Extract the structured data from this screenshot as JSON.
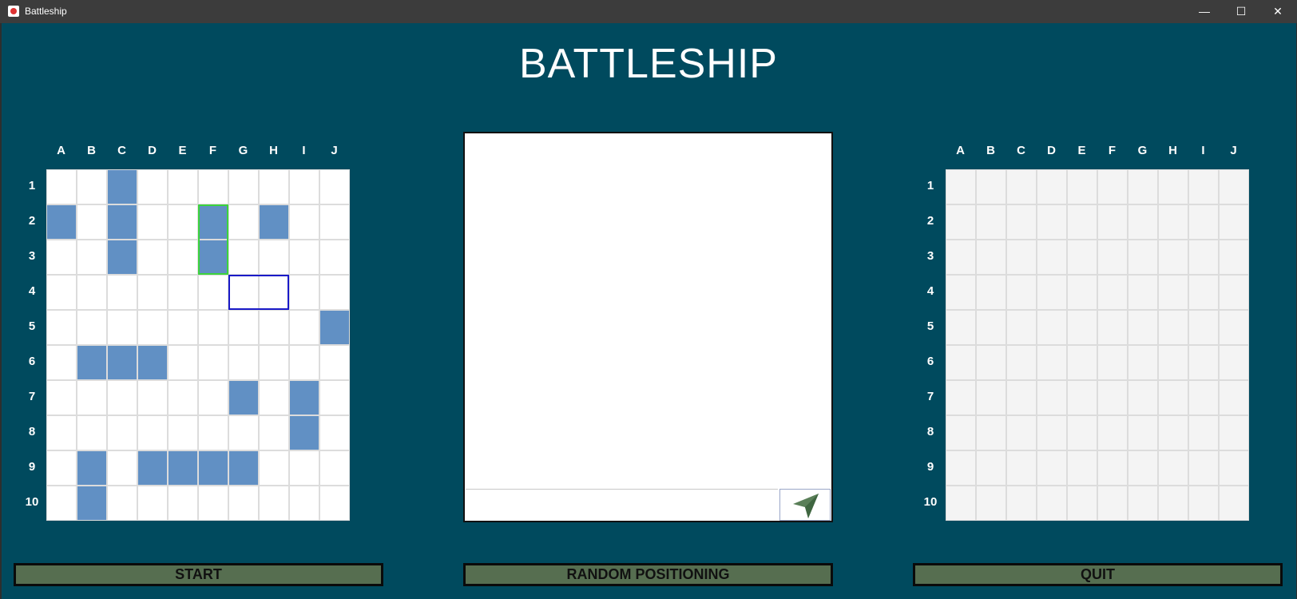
{
  "window": {
    "title": "Battleship",
    "controls": {
      "minimize": "—",
      "maximize": "☐",
      "close": "✕"
    }
  },
  "game_title": "BATTLESHIP",
  "column_labels": [
    "A",
    "B",
    "C",
    "D",
    "E",
    "F",
    "G",
    "H",
    "I",
    "J"
  ],
  "row_labels": [
    "1",
    "2",
    "3",
    "4",
    "5",
    "6",
    "7",
    "8",
    "9",
    "10"
  ],
  "player_board": {
    "ship_cells": [
      "C1",
      "C2",
      "C3",
      "A2",
      "F2",
      "F3",
      "H2",
      "J5",
      "B6",
      "C6",
      "D6",
      "G7",
      "I7",
      "I8",
      "B9",
      "B10",
      "D9",
      "E9",
      "F9",
      "G9"
    ],
    "selected_ship_cells": [
      "F2",
      "F3"
    ],
    "placement_preview_cells": [
      "G4",
      "H4"
    ],
    "colors": {
      "ship": "#6190C4",
      "selected_outline": "#3CD33C",
      "preview_outline": "#1A1AC8",
      "water": "#FFFFFF"
    }
  },
  "enemy_board": {
    "colors": {
      "water": "#F4F4F4"
    }
  },
  "chat": {
    "input_value": "",
    "send_icon": "paper-plane-icon"
  },
  "buttons": {
    "start": "START",
    "random_positioning": "RANDOM POSITIONING",
    "quit": "QUIT"
  }
}
